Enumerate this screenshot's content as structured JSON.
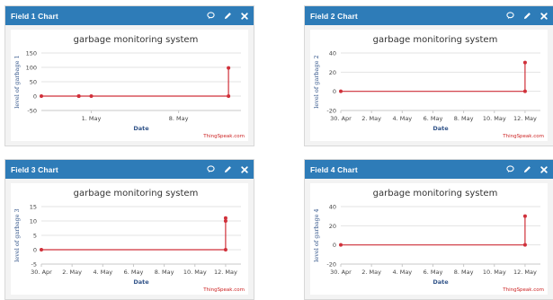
{
  "colors": {
    "header": "#2e7cb8",
    "series": "#d0303a",
    "axis_label": "#33558a",
    "credit": "#cc2222"
  },
  "icons": {
    "comment": "comment-icon",
    "edit": "pencil-icon",
    "close": "close-icon"
  },
  "panels": [
    {
      "title": "Field 1 Chart"
    },
    {
      "title": "Field 2 Chart"
    },
    {
      "title": "Field 3 Chart"
    },
    {
      "title": "Field 4 Chart"
    }
  ],
  "chart_data": [
    {
      "type": "line",
      "title": "garbage monitoring system",
      "xlabel": "Date",
      "ylabel": "level of garbage 1",
      "credit": "ThingSpeak.com",
      "xlim": [
        "2018-04-27",
        "2018-05-13"
      ],
      "ylim": [
        -50,
        150
      ],
      "x_ticks": [
        "1. May",
        "8. May"
      ],
      "y_ticks": [
        "-50",
        "0",
        "50",
        "100",
        "150"
      ],
      "grid": true,
      "series": [
        {
          "x": [
            "2018-04-27",
            "2018-04-30",
            "2018-04-30",
            "2018-05-01",
            "2018-05-12",
            "2018-05-12"
          ],
          "y": [
            0,
            0,
            0,
            0,
            0,
            98
          ]
        }
      ]
    },
    {
      "type": "line",
      "title": "garbage monitoring system",
      "xlabel": "Date",
      "ylabel": "level of garbage 2",
      "credit": "ThingSpeak.com",
      "xlim": [
        "2018-04-30",
        "2018-05-13"
      ],
      "ylim": [
        -20,
        40
      ],
      "x_ticks": [
        "30. Apr",
        "2. May",
        "4. May",
        "6. May",
        "8. May",
        "10. May",
        "12. May"
      ],
      "y_ticks": [
        "-20",
        "0",
        "20",
        "40"
      ],
      "grid": true,
      "series": [
        {
          "x": [
            "2018-04-30",
            "2018-05-12",
            "2018-05-12"
          ],
          "y": [
            0,
            0,
            30
          ]
        }
      ]
    },
    {
      "type": "line",
      "title": "garbage monitoring system",
      "xlabel": "Date",
      "ylabel": "level of garbage 3",
      "credit": "ThingSpeak.com",
      "xlim": [
        "2018-04-30",
        "2018-05-13"
      ],
      "ylim": [
        -5,
        15
      ],
      "x_ticks": [
        "30. Apr",
        "2. May",
        "4. May",
        "6. May",
        "8. May",
        "10. May",
        "12. May"
      ],
      "y_ticks": [
        "-5",
        "0",
        "5",
        "10",
        "15"
      ],
      "grid": true,
      "series": [
        {
          "x": [
            "2018-04-30",
            "2018-05-12",
            "2018-05-12",
            "2018-05-12"
          ],
          "y": [
            0,
            0,
            10,
            11
          ]
        }
      ]
    },
    {
      "type": "line",
      "title": "garbage monitoring system",
      "xlabel": "Date",
      "ylabel": "level of garbage 4",
      "credit": "ThingSpeak.com",
      "xlim": [
        "2018-04-30",
        "2018-05-13"
      ],
      "ylim": [
        -20,
        40
      ],
      "x_ticks": [
        "30. Apr",
        "2. May",
        "4. May",
        "6. May",
        "8. May",
        "10. May",
        "12. May"
      ],
      "y_ticks": [
        "-20",
        "0",
        "20",
        "40"
      ],
      "grid": true,
      "series": [
        {
          "x": [
            "2018-04-30",
            "2018-05-12",
            "2018-05-12"
          ],
          "y": [
            0,
            0,
            30
          ]
        }
      ]
    }
  ]
}
